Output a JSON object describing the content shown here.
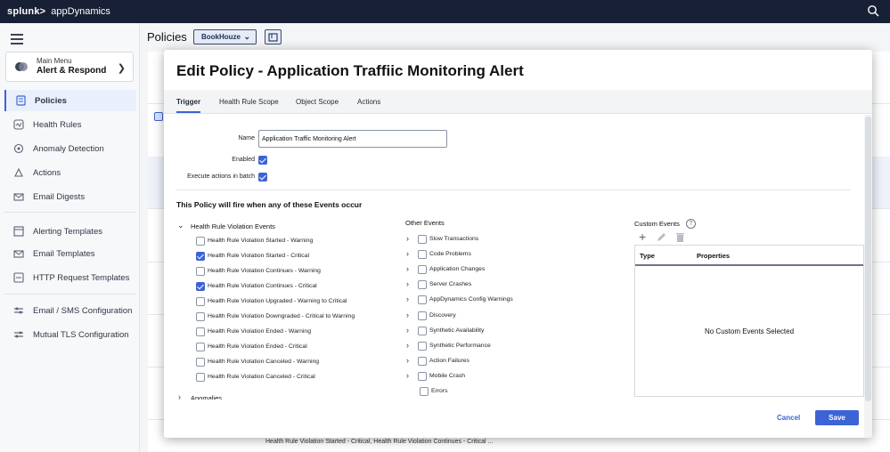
{
  "topbar": {
    "brand": "splunk>",
    "product": "appDynamics"
  },
  "sidebar": {
    "menu_card": {
      "sub": "Main Menu",
      "main": "Alert & Respond"
    },
    "items": [
      {
        "label": "Policies",
        "active": true
      },
      {
        "label": "Health Rules"
      },
      {
        "label": "Anomaly Detection"
      },
      {
        "label": "Actions"
      },
      {
        "label": "Email Digests"
      },
      {
        "label": "Alerting Templates"
      },
      {
        "label": "Email Templates"
      },
      {
        "label": "HTTP Request Templates"
      },
      {
        "label": "Email / SMS Configuration"
      },
      {
        "label": "Mutual TLS Configuration"
      }
    ]
  },
  "main": {
    "title": "Policies",
    "app_selector": "BookHouze",
    "background_row_text": "Health Rule Violation Started - Critical, Health Rule Violation Continues - Critical ..."
  },
  "modal": {
    "title": "Edit Policy - Application Traffiic Monitoring Alert",
    "tabs": [
      "Trigger",
      "Health Rule Scope",
      "Object Scope",
      "Actions"
    ],
    "name_label": "Name",
    "name_value": "Application Traffic Monitoring Alert",
    "enabled_label": "Enabled",
    "batch_label": "Execute actions in batch",
    "section_title": "This Policy will fire when any of these Events occur",
    "hrv_group": "Health Rule Violation Events",
    "hrv_events": [
      {
        "label": "Health Rule Violation Started - Warning",
        "checked": false
      },
      {
        "label": "Health Rule Violation Started - Critical",
        "checked": true
      },
      {
        "label": "Health Rule Violation Continues - Warning",
        "checked": false
      },
      {
        "label": "Health Rule Violation Continues - Critical",
        "checked": true
      },
      {
        "label": "Health Rule Violation Upgraded - Warning to Critical",
        "checked": false
      },
      {
        "label": "Health Rule Violation Downgraded - Critical to Warning",
        "checked": false
      },
      {
        "label": "Health Rule Violation Ended - Warning",
        "checked": false
      },
      {
        "label": "Health Rule Violation Ended - Critical",
        "checked": false
      },
      {
        "label": "Health Rule Violation Canceled - Warning",
        "checked": false
      },
      {
        "label": "Health Rule Violation Canceled - Critical",
        "checked": false
      }
    ],
    "second_group": "Anomalies",
    "other_events_title": "Other Events",
    "other_events": [
      "Slow Transactions",
      "Code Problems",
      "Application Changes",
      "Server Crashes",
      "AppDynamics Config Warnings",
      "Discovery",
      "Synthetic Availability",
      "Synthetic Performance",
      "Action Failures",
      "Mobile Crash",
      "Errors"
    ],
    "custom_events_title": "Custom Events",
    "ce_columns": [
      "Type",
      "Properties"
    ],
    "ce_empty": "No Custom Events Selected",
    "cancel_label": "Cancel",
    "save_label": "Save"
  }
}
